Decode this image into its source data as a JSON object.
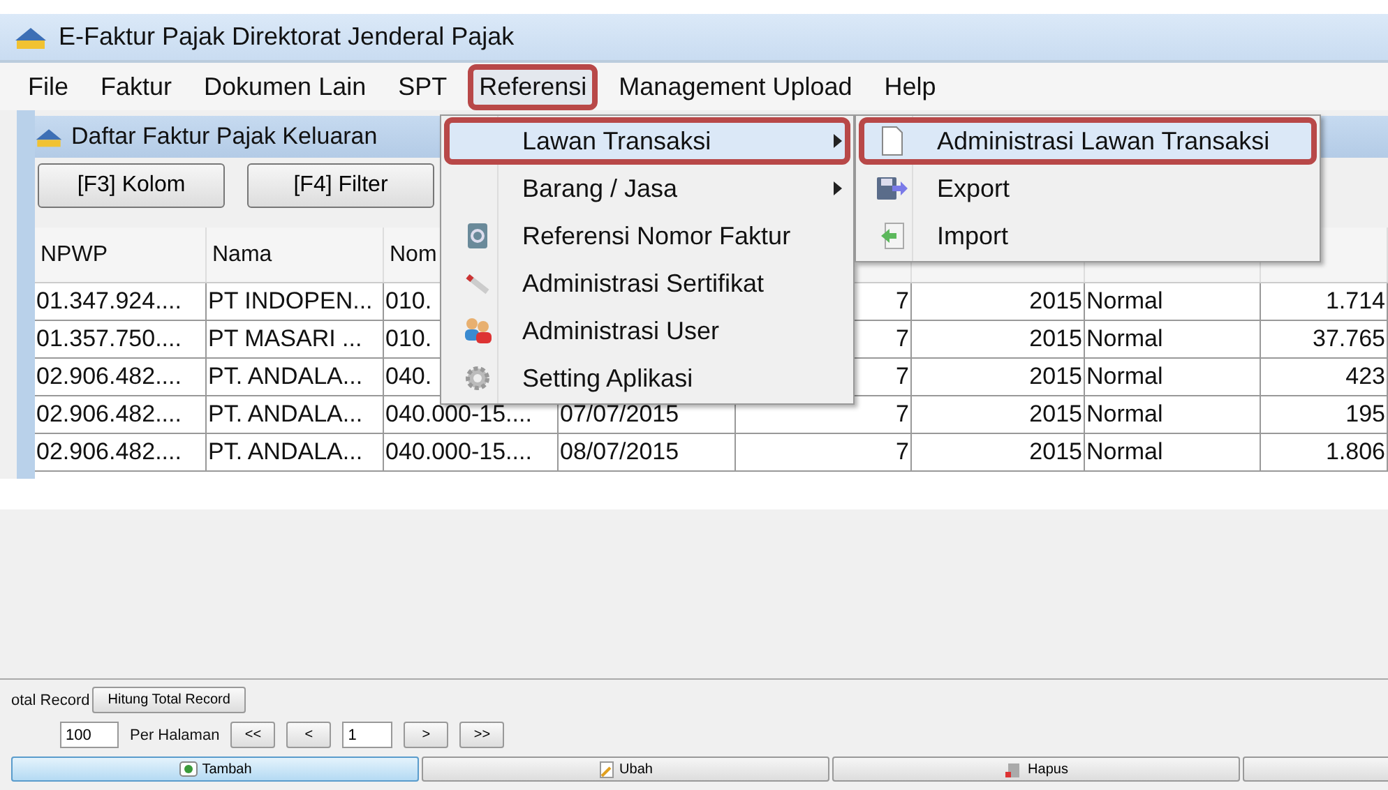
{
  "window": {
    "title": "E-Faktur Pajak Direktorat Jenderal Pajak"
  },
  "menubar": [
    {
      "label": "File",
      "selected": false
    },
    {
      "label": "Faktur",
      "selected": false
    },
    {
      "label": "Dokumen Lain",
      "selected": false
    },
    {
      "label": "SPT",
      "selected": false
    },
    {
      "label": "Referensi",
      "selected": true
    },
    {
      "label": "Management Upload",
      "selected": false
    },
    {
      "label": "Help",
      "selected": false
    }
  ],
  "menu": {
    "items": [
      {
        "label": "Lawan Transaksi",
        "kind": "submenu",
        "selected": true
      },
      {
        "label": "Barang / Jasa",
        "kind": "submenu",
        "selected": false
      },
      {
        "label": "Referensi Nomor Faktur",
        "kind": "item",
        "selected": false
      },
      {
        "label": "Administrasi Sertifikat",
        "kind": "item",
        "selected": false
      },
      {
        "label": "Administrasi User",
        "kind": "item",
        "selected": false
      },
      {
        "label": "Setting Aplikasi",
        "kind": "item",
        "selected": false
      }
    ],
    "submenu": [
      {
        "label": "Administrasi Lawan Transaksi",
        "selected": true
      },
      {
        "label": "Export",
        "selected": false
      },
      {
        "label": "Import",
        "selected": false
      }
    ]
  },
  "frame": {
    "title": "Daftar Faktur Pajak Keluaran",
    "buttons": [
      "[F3] Kolom",
      "[F4] Filter"
    ]
  },
  "table": {
    "columns": [
      "NPWP",
      "Nama",
      "Nom"
    ],
    "rows": [
      {
        "cells": [
          "01.347.924....",
          "PT INDOPEN...",
          "010."
        ],
        "column_5": "7",
        "column_6": "2015",
        "column_7": "Normal",
        "column_8": "1.714"
      },
      {
        "cells": [
          "01.357.750....",
          "PT MASARI ...",
          "010."
        ],
        "column_5": "7",
        "column_6": "2015",
        "column_7": "Normal",
        "column_8": "37.765"
      },
      {
        "cells": [
          "02.906.482....",
          "PT. ANDALA...",
          "040."
        ],
        "column_5": "7",
        "column_6": "2015",
        "column_7": "Normal",
        "column_8": "423"
      },
      {
        "cells": [
          "02.906.482....",
          "PT. ANDALA...",
          "040.000-15....",
          "07/07/2015"
        ],
        "column_5": "7",
        "column_6": "2015",
        "column_7": "Normal",
        "column_8": "195"
      },
      {
        "cells": [
          "02.906.482....",
          "PT. ANDALA...",
          "040.000-15....",
          "08/07/2015"
        ],
        "column_5": "7",
        "column_6": "2015",
        "column_7": "Normal",
        "column_8": "1.806"
      }
    ]
  },
  "footer": {
    "total_label": "otal Record",
    "total_button": "Hitung Total Record",
    "page_size": "100",
    "page_size_label": "Per Halaman",
    "nav": [
      "<<",
      "<"
    ],
    "page": "1",
    "nav_next": [
      ">",
      ">>"
    ],
    "actions": [
      {
        "label": "Tambah",
        "selected": true
      },
      {
        "label": "Ubah",
        "selected": false
      },
      {
        "label": "Hapus",
        "selected": false
      }
    ]
  }
}
